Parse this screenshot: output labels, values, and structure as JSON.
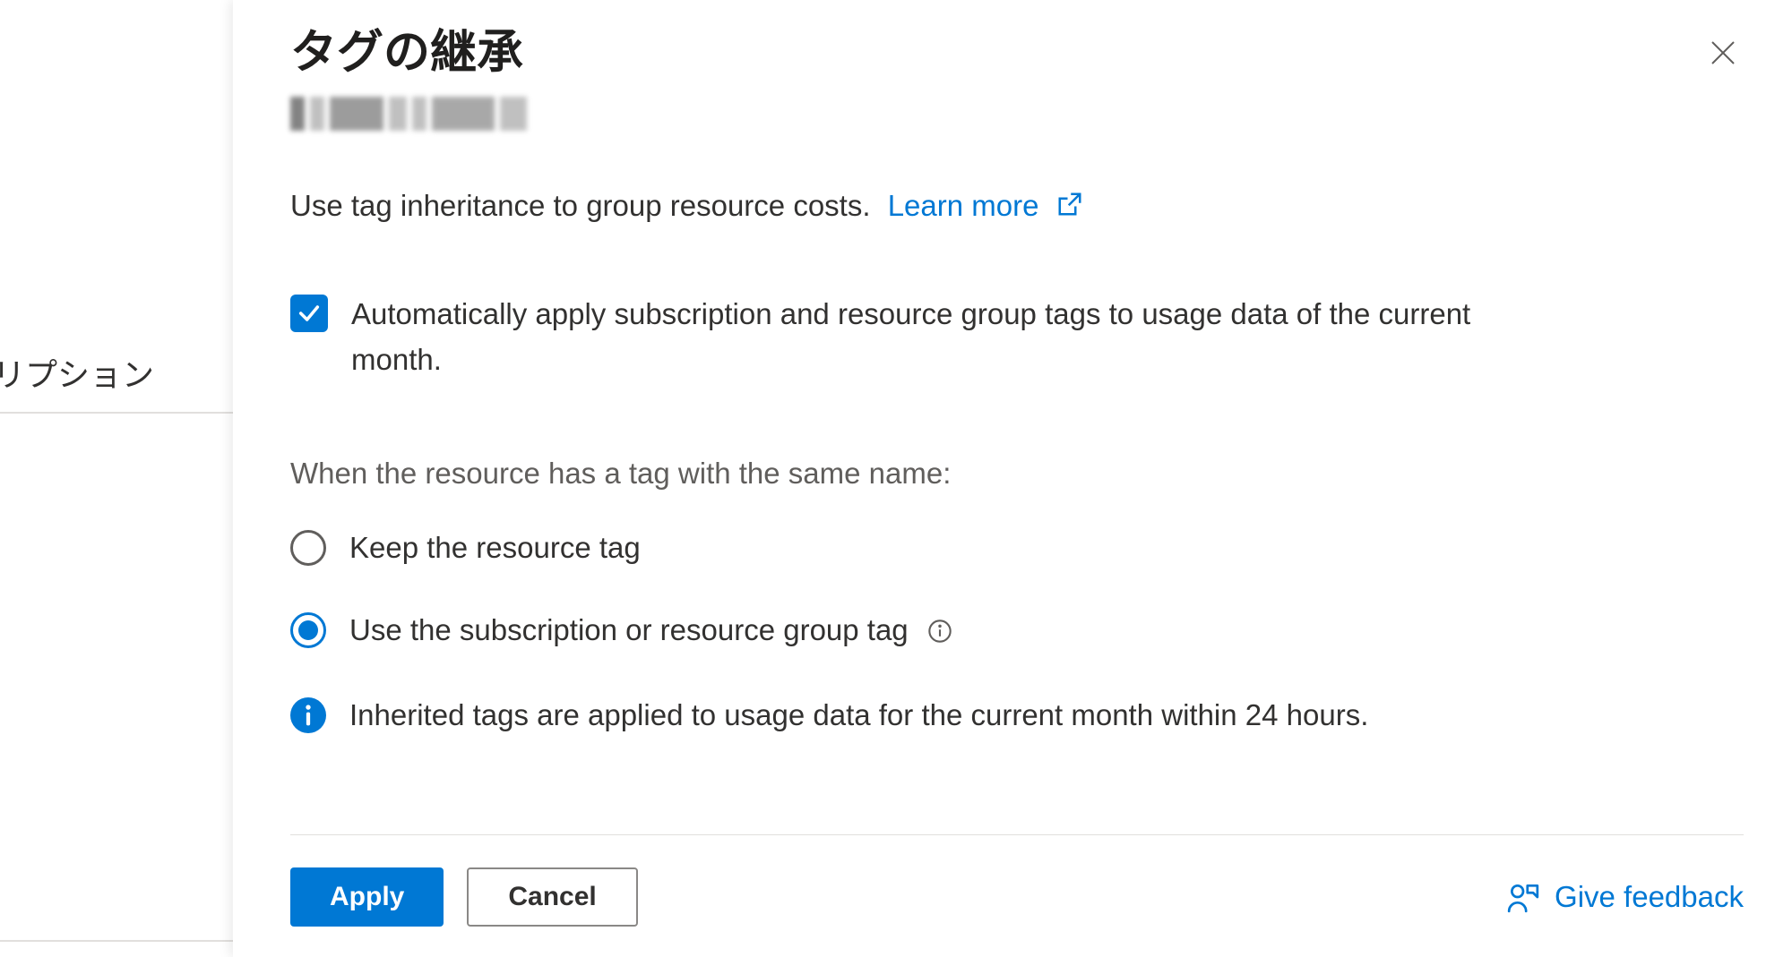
{
  "sidebar": {
    "partial_text": "スクリプション"
  },
  "panel": {
    "title": "タグの継承",
    "description": "Use tag inheritance to group resource costs.",
    "learn_more_label": "Learn more",
    "checkbox_label": "Automatically apply subscription and resource group tags to usage data of the current month.",
    "checkbox_checked": true,
    "radio_heading": "When the resource has a tag with the same name:",
    "radios": [
      {
        "label": "Keep the resource tag",
        "selected": false
      },
      {
        "label": "Use the subscription or resource group tag",
        "selected": true
      }
    ],
    "info_message": "Inherited tags are applied to usage data for the current month within 24 hours."
  },
  "footer": {
    "apply_label": "Apply",
    "cancel_label": "Cancel",
    "feedback_label": "Give feedback"
  }
}
